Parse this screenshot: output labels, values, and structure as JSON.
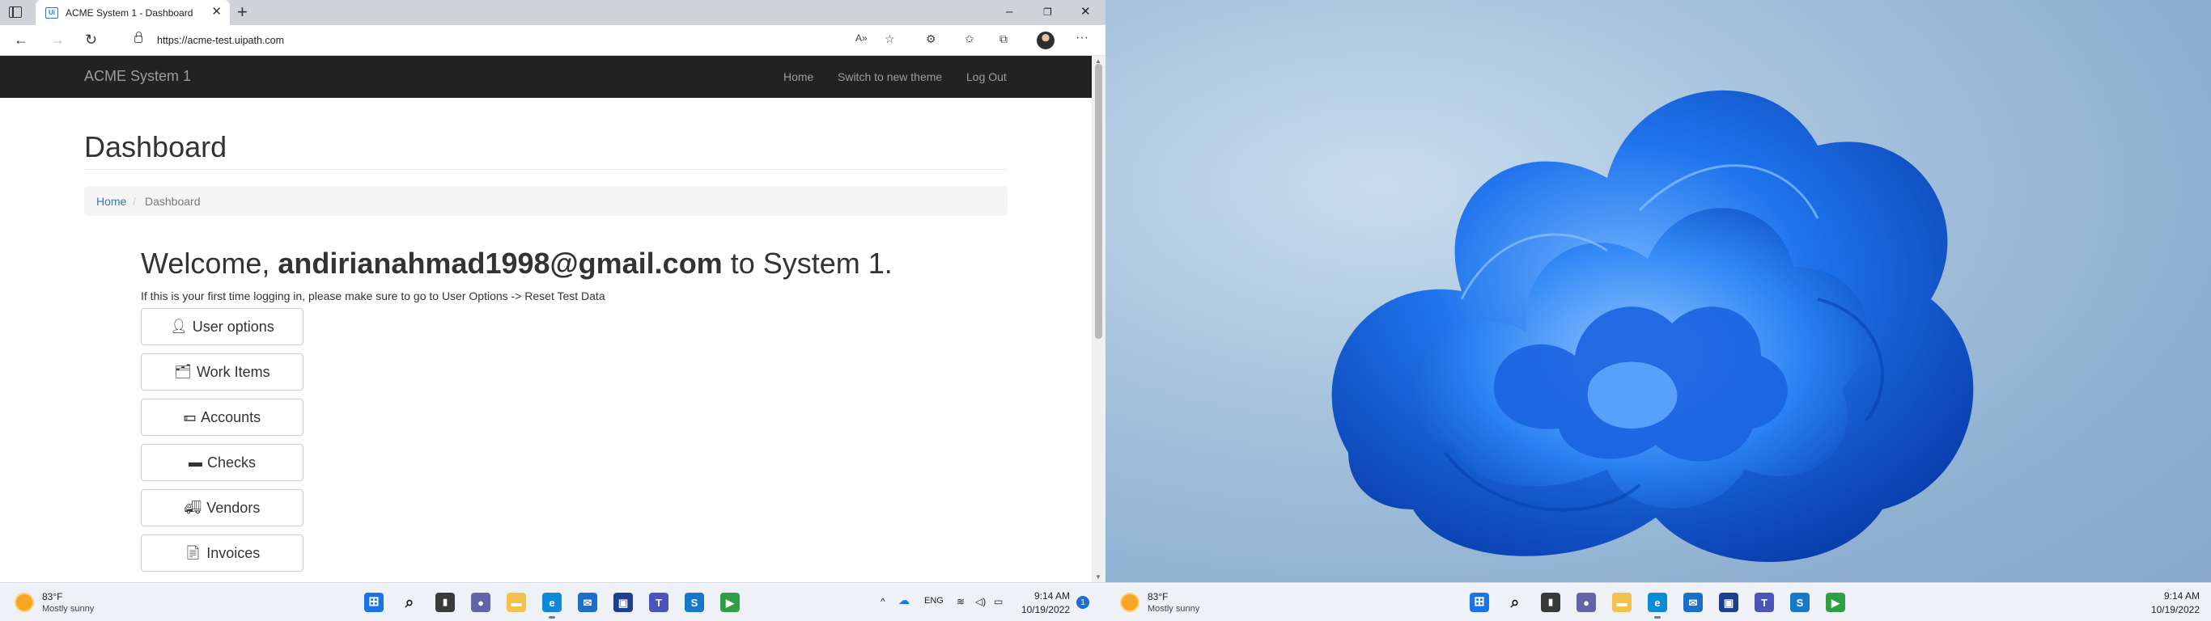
{
  "browser": {
    "tab_title": "ACME System 1 - Dashboard",
    "tab_favicon": "Ui",
    "url": "https://acme-test.uipath.com"
  },
  "site": {
    "brand": "ACME System 1",
    "nav": [
      "Home",
      "Switch to new theme",
      "Log Out"
    ],
    "heading": "Dashboard",
    "breadcrumb": {
      "home": "Home",
      "separator": "/",
      "current": "Dashboard"
    },
    "welcome_prefix": "Welcome, ",
    "welcome_user": "andirianahmad1998@gmail.com",
    "welcome_suffix": " to System 1.",
    "notice": "If this is your first time logging in, please make sure to go to User Options -> Reset Test Data",
    "buttons": [
      {
        "label": "User options",
        "icon": "user-icon"
      },
      {
        "label": "Work Items",
        "icon": "folder-open-icon"
      },
      {
        "label": "Accounts",
        "icon": "money-icon"
      },
      {
        "label": "Checks",
        "icon": "credit-card-icon"
      },
      {
        "label": "Vendors",
        "icon": "truck-icon"
      },
      {
        "label": "Invoices",
        "icon": "file-icon"
      }
    ]
  },
  "taskbar": {
    "weather_temp": "83°F",
    "weather_desc": "Mostly sunny",
    "language": "ENG",
    "time": "9:14 AM",
    "date": "10/19/2022",
    "notification_count": "1"
  },
  "taskbar_right": {
    "weather_temp": "83°F",
    "weather_desc": "Mostly sunny",
    "time": "9:14 AM",
    "date": "10/19/2022"
  },
  "colors": {
    "navbar_bg": "#222222",
    "link": "#337ab7",
    "wallpaper_blue": "#1565d8"
  }
}
